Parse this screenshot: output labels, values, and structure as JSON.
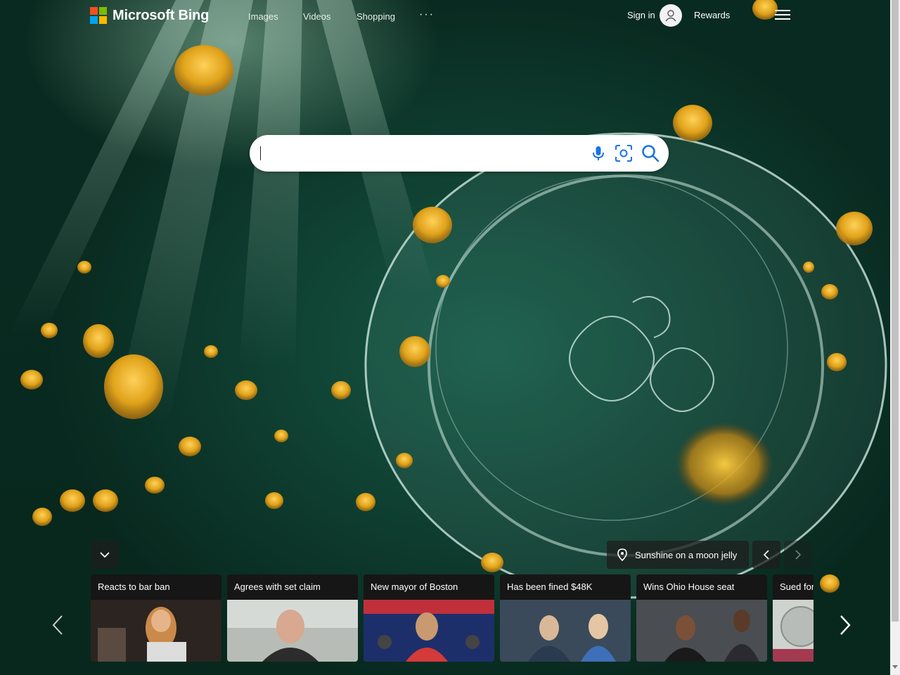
{
  "header": {
    "logo_text": "Microsoft Bing",
    "logo_colors": [
      "#f25022",
      "#7fba00",
      "#00a4ef",
      "#ffb900"
    ],
    "nav": [
      "Images",
      "Videos",
      "Shopping"
    ],
    "more": "···",
    "signin": "Sign in",
    "rewards": "Rewards"
  },
  "search": {
    "value": "",
    "icons": [
      "microphone-icon",
      "visual-search-icon",
      "search-icon"
    ],
    "accent": "#1a73e8"
  },
  "image_caption": "Sunshine on a moon jelly",
  "news_cards": [
    {
      "title": "Reacts to bar ban"
    },
    {
      "title": "Agrees with set claim"
    },
    {
      "title": "New mayor of Boston"
    },
    {
      "title": "Has been fined $48K"
    },
    {
      "title": "Wins Ohio House seat"
    },
    {
      "title": "Sued for"
    }
  ]
}
